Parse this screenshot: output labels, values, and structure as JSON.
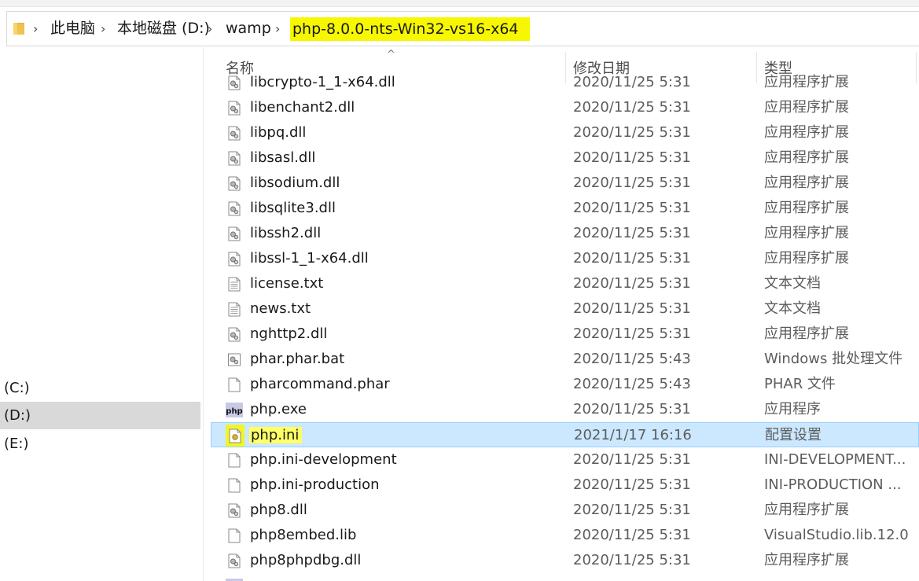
{
  "breadcrumb": {
    "items": [
      {
        "label": "此电脑"
      },
      {
        "label": "本地磁盘 (D:)"
      },
      {
        "label": "wamp"
      },
      {
        "label": "php-8.0.0-nts-Win32-vs16-x64"
      }
    ]
  },
  "columns": {
    "name": "名称",
    "date": "修改日期",
    "type": "类型"
  },
  "drives": [
    {
      "label": "(C:)"
    },
    {
      "label": "(D:)"
    },
    {
      "label": "(E:)"
    }
  ],
  "files": [
    {
      "name": "libcrypto-1_1-x64.dll",
      "date": "2020/11/25 5:31",
      "type": "应用程序扩展",
      "icon": "dll-icon"
    },
    {
      "name": "libenchant2.dll",
      "date": "2020/11/25 5:31",
      "type": "应用程序扩展",
      "icon": "dll-icon"
    },
    {
      "name": "libpq.dll",
      "date": "2020/11/25 5:31",
      "type": "应用程序扩展",
      "icon": "dll-icon"
    },
    {
      "name": "libsasl.dll",
      "date": "2020/11/25 5:31",
      "type": "应用程序扩展",
      "icon": "dll-icon"
    },
    {
      "name": "libsodium.dll",
      "date": "2020/11/25 5:31",
      "type": "应用程序扩展",
      "icon": "dll-icon"
    },
    {
      "name": "libsqlite3.dll",
      "date": "2020/11/25 5:31",
      "type": "应用程序扩展",
      "icon": "dll-icon"
    },
    {
      "name": "libssh2.dll",
      "date": "2020/11/25 5:31",
      "type": "应用程序扩展",
      "icon": "dll-icon"
    },
    {
      "name": "libssl-1_1-x64.dll",
      "date": "2020/11/25 5:31",
      "type": "应用程序扩展",
      "icon": "dll-icon"
    },
    {
      "name": "license.txt",
      "date": "2020/11/25 5:31",
      "type": "文本文档",
      "icon": "text-file-icon"
    },
    {
      "name": "news.txt",
      "date": "2020/11/25 5:31",
      "type": "文本文档",
      "icon": "text-file-icon"
    },
    {
      "name": "nghttp2.dll",
      "date": "2020/11/25 5:31",
      "type": "应用程序扩展",
      "icon": "dll-icon"
    },
    {
      "name": "phar.phar.bat",
      "date": "2020/11/25 5:43",
      "type": "Windows 批处理文件",
      "icon": "batch-file-icon"
    },
    {
      "name": "pharcommand.phar",
      "date": "2020/11/25 5:43",
      "type": "PHAR 文件",
      "icon": "blank-file-icon"
    },
    {
      "name": "php.exe",
      "date": "2020/11/25 5:31",
      "type": "应用程序",
      "icon": "php-exe-icon"
    },
    {
      "name": "php.ini",
      "date": "2021/1/17 16:16",
      "type": "配置设置",
      "icon": "config-file-icon",
      "selected": true
    },
    {
      "name": "php.ini-development",
      "date": "2020/11/25 5:31",
      "type": "INI-DEVELOPMENT...",
      "icon": "blank-file-icon"
    },
    {
      "name": "php.ini-production",
      "date": "2020/11/25 5:31",
      "type": "INI-PRODUCTION ...",
      "icon": "blank-file-icon"
    },
    {
      "name": "php8.dll",
      "date": "2020/11/25 5:31",
      "type": "应用程序扩展",
      "icon": "dll-icon"
    },
    {
      "name": "php8embed.lib",
      "date": "2020/11/25 5:31",
      "type": "VisualStudio.lib.12.0",
      "icon": "blank-file-icon"
    },
    {
      "name": "php8phpdbg.dll",
      "date": "2020/11/25 5:31",
      "type": "应用程序扩展",
      "icon": "dll-icon"
    },
    {
      "name": "",
      "date": "",
      "type": "",
      "icon": "php-exe-icon"
    }
  ],
  "colors": {
    "selection_bg": "#cce8ff",
    "selection_border": "#99d1ff",
    "highlight_marker": "#f7f700",
    "nav_selected_bg": "#d9d9d9"
  }
}
